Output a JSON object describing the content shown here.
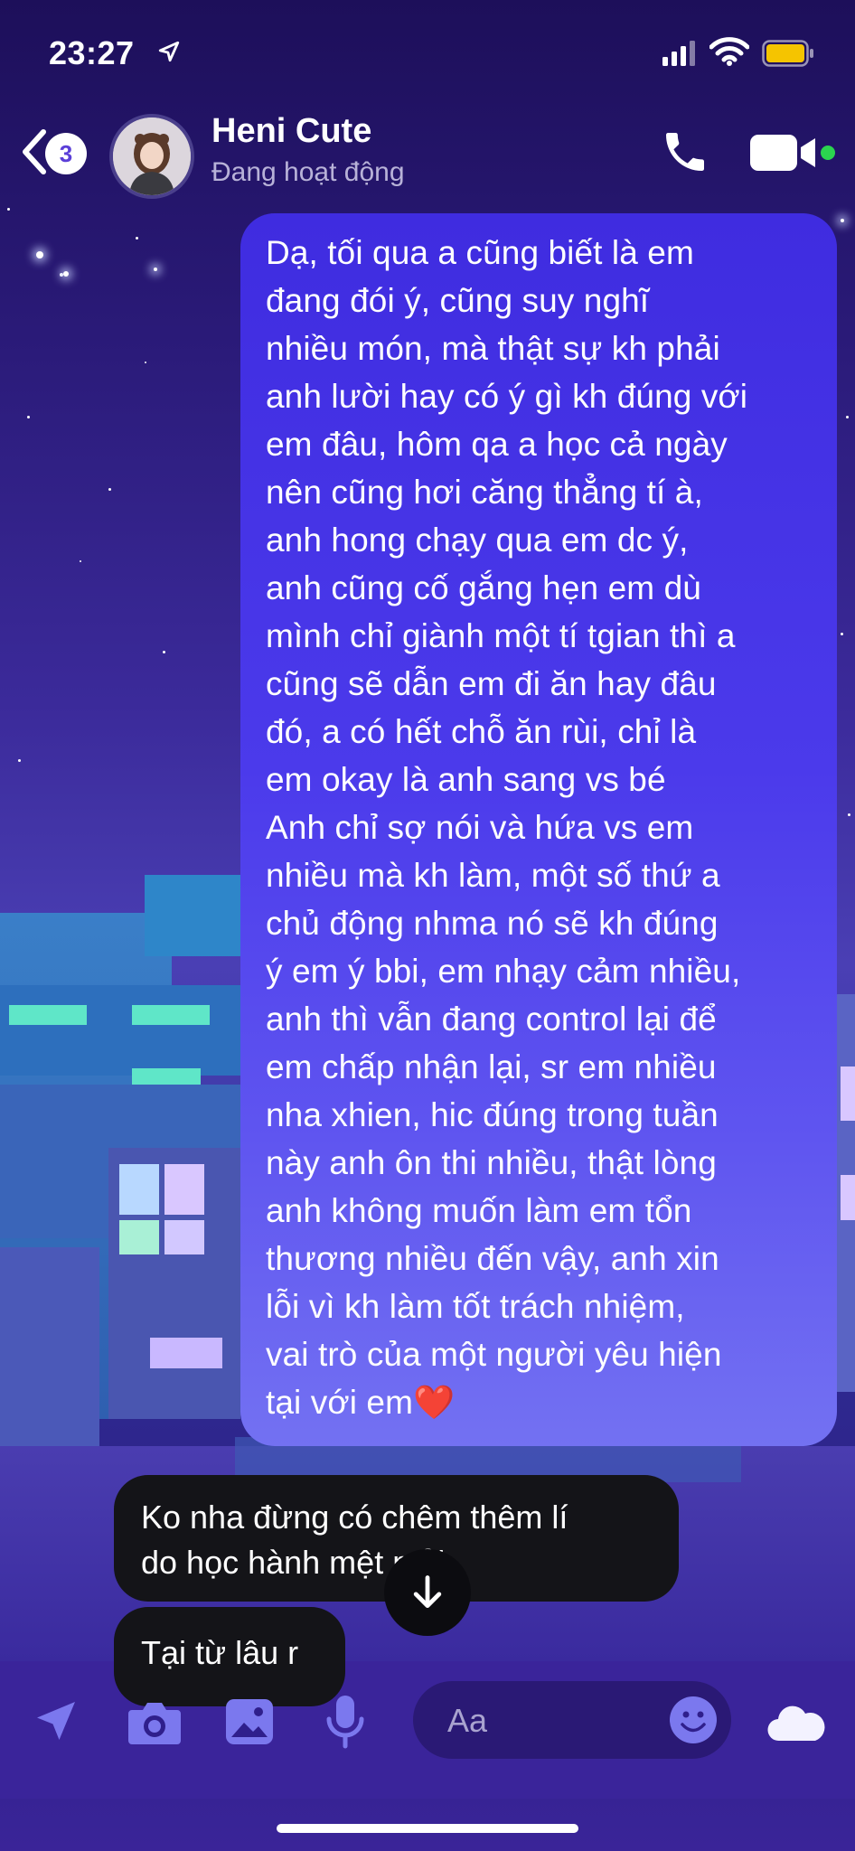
{
  "status_bar": {
    "time": "23:27",
    "icons": [
      "location-arrow-icon",
      "signal-icon",
      "wifi-icon",
      "battery-icon"
    ],
    "battery_color": "#f5c400"
  },
  "header": {
    "back_badge_count": "3",
    "contact_name": "Heni Cute",
    "contact_status": "Đang hoạt động",
    "online_color": "#2bd44f",
    "actions": [
      "phone-icon",
      "video-camera-icon"
    ]
  },
  "messages": [
    {
      "direction": "outgoing",
      "text": "Dạ, tối qua a cũng biết là em\nđang đói ý, cũng suy nghĩ\nnhiều món, mà thật sự kh phải\nanh lười hay có ý gì kh đúng với\nem đâu, hôm qa a học cả ngày\nnên cũng hơi căng thẳng tí à,\nanh hong chạy qua em dc ý,\nanh cũng cố gắng hẹn em dù\nmình chỉ giành một tí tgian thì a\ncũng sẽ dẫn em đi ăn hay đâu\nđó, a có hết chỗ ăn rùi, chỉ là\nem okay là anh sang vs bé\nAnh chỉ sợ nói và hứa vs em\nnhiều mà kh làm, một số thứ a\nchủ động nhma nó sẽ kh đúng\ný em ý bbi, em nhạy cảm nhiều,\nanh thì vẫn đang control lại để\nem chấp nhận lại, sr em nhiều\nnha xhien, hic đúng trong tuần\nnày anh ôn thi nhiều, thật lòng\nanh không muốn làm em tổn\nthương nhiều đến vậy, anh xin\nlỗi vì kh làm tốt trách nhiệm,\nvai trò của một người yêu hiện\ntại với em❤️"
    },
    {
      "direction": "incoming",
      "text": "Ko nha đừng có chêm thêm lí\ndo học hành mệt mỏi"
    },
    {
      "direction": "incoming",
      "text": "Tại từ lâu r"
    }
  ],
  "scroll_button": {
    "icon": "arrow-down-icon"
  },
  "composer": {
    "placeholder": "Aa",
    "icons": [
      "send-arrow-icon",
      "camera-icon",
      "gallery-icon",
      "microphone-icon",
      "emoji-icon",
      "cloud-icon"
    ],
    "icon_color": "#7b78ee"
  }
}
